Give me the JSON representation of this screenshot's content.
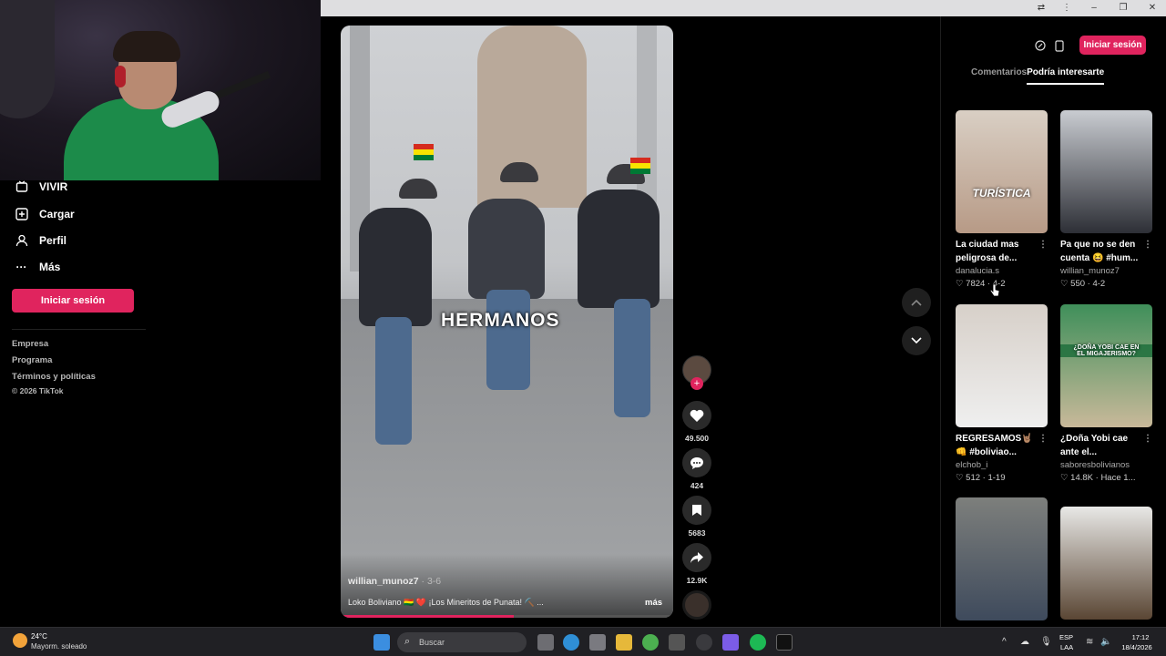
{
  "sidebar": {
    "items": [
      {
        "label": "VIVIR",
        "icon": "live-icon"
      },
      {
        "label": "Cargar",
        "icon": "upload-icon"
      },
      {
        "label": "Perfil",
        "icon": "profile-icon"
      },
      {
        "label": "Más",
        "icon": "more-icon"
      }
    ],
    "login_label": "Iniciar sesión",
    "footer": [
      "Empresa",
      "Programa",
      "Términos y políticas",
      "© 2026 TikTok"
    ]
  },
  "video": {
    "overlay_text": "HERMANOS",
    "author": "willian_munoz7",
    "date": "· 3-6",
    "description": "Loko Boliviano 🇧🇴 ❤️ ¡Los Mineritos de Punata! ⛏️ ...",
    "more_label": "más",
    "progress": 0.52
  },
  "actions": {
    "likes": "49.500",
    "comments": "424",
    "saves": "5683",
    "shares": "12.9K"
  },
  "panel": {
    "login_label": "Iniciar sesión",
    "tabs": {
      "comments": "Comentarios",
      "suggested": "Podría interesarte"
    }
  },
  "cards": [
    {
      "title": "La ciudad mas peligrosa de...",
      "author": "danalucia.s",
      "likes": "7824",
      "date": "4-2",
      "overlay": "TURÍSTICA",
      "colors": [
        "#d9cfc4",
        "#b79a86"
      ]
    },
    {
      "title": "Pa que no se den cuenta 😆 #hum...",
      "author": "willian_munoz7",
      "likes": "550",
      "date": "4-2",
      "overlay": "",
      "colors": [
        "#c9ccd1",
        "#2d2f36"
      ]
    },
    {
      "title": "REGRESAMOS🤘🏽 👊 #boliviao...",
      "author": "elchob_i",
      "likes": "512",
      "date": "1-19",
      "overlay": "",
      "colors": [
        "#d7d0c9",
        "#efefef"
      ]
    },
    {
      "title": "¿Doña Yobi cae ante el...",
      "author": "saboresbolivianos",
      "likes": "14.8K",
      "date": "Hace 1...",
      "overlay": "¿DOÑA YOBI CAE EN EL MIGAJERISMO?",
      "colors": [
        "#3f8f5a",
        "#c9b99a"
      ]
    },
    {
      "title": "",
      "author": "",
      "likes": "",
      "date": "",
      "overlay": "",
      "colors": [
        "#7d7f7c",
        "#3e4a5c"
      ]
    },
    {
      "title": "",
      "author": "",
      "likes": "",
      "date": "",
      "overlay": "",
      "colors": [
        "#e8e8e6",
        "#5a4634"
      ]
    }
  ],
  "taskbar": {
    "temperature": "24°C",
    "weather": "Mayorm. soleado",
    "search_placeholder": "Buscar",
    "lang_top": "ESP",
    "lang_bottom": "LAA",
    "time": "17:12",
    "date": "18/4/2026"
  }
}
